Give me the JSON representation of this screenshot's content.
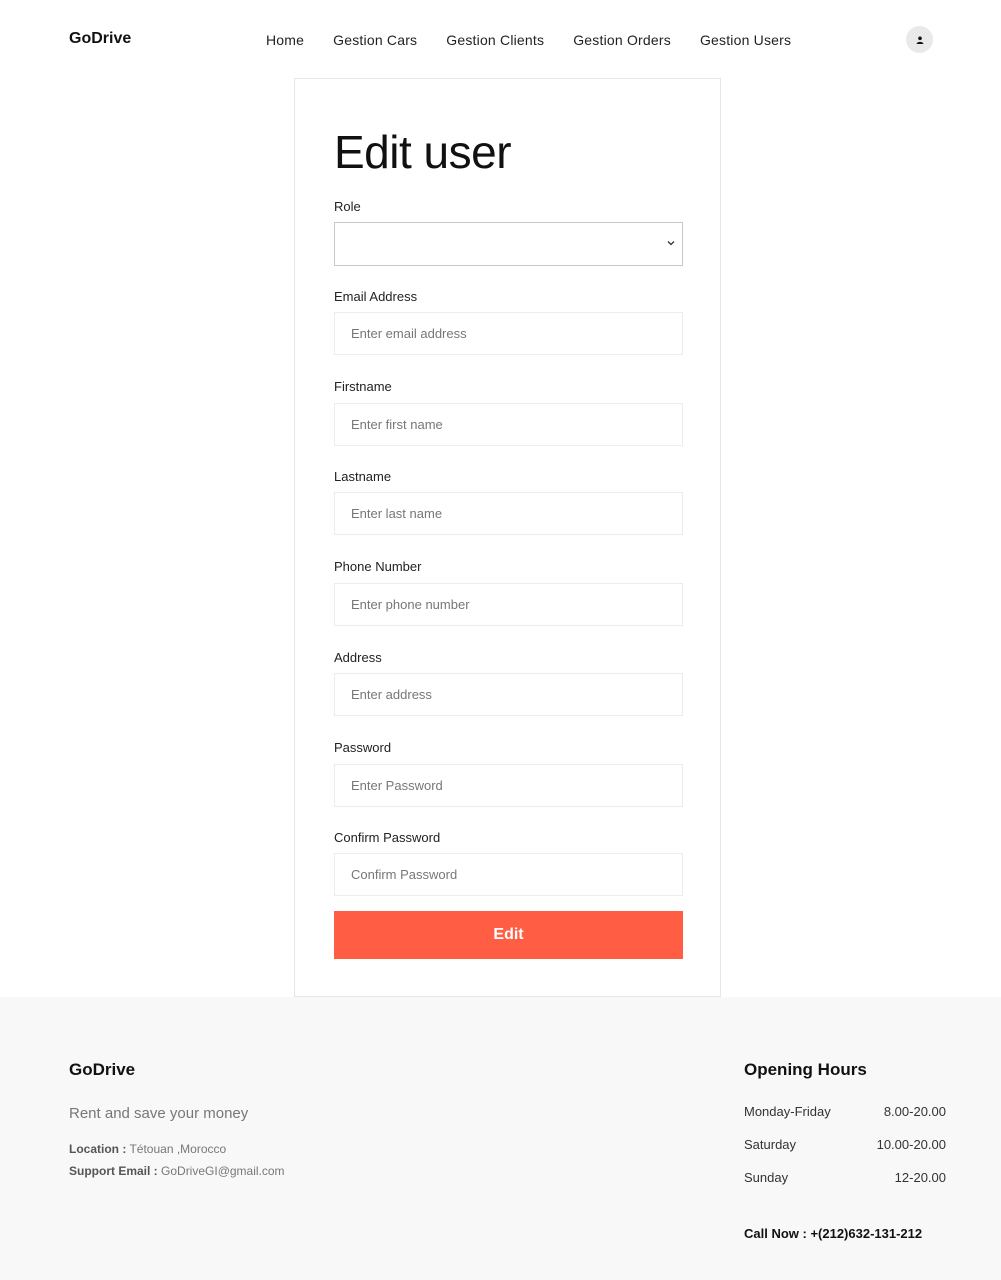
{
  "header": {
    "brand": "GoDrive",
    "nav": [
      {
        "label": "Home"
      },
      {
        "label": "Gestion Cars"
      },
      {
        "label": "Gestion Clients"
      },
      {
        "label": "Gestion Orders"
      },
      {
        "label": "Gestion Users"
      }
    ],
    "avatar_icon": "user-icon"
  },
  "form": {
    "title": "Edit user",
    "role": {
      "label": "Role",
      "value": ""
    },
    "email": {
      "label": "Email Address",
      "placeholder": "Enter email address",
      "value": ""
    },
    "firstname": {
      "label": "Firstname",
      "placeholder": "Enter first name",
      "value": ""
    },
    "lastname": {
      "label": "Lastname",
      "placeholder": "Enter last name",
      "value": ""
    },
    "phone": {
      "label": "Phone Number",
      "placeholder": "Enter phone number",
      "value": ""
    },
    "address": {
      "label": "Address",
      "placeholder": "Enter address",
      "value": ""
    },
    "password": {
      "label": "Password",
      "placeholder": "Enter Password",
      "value": ""
    },
    "confirm_password": {
      "label": "Confirm Password",
      "placeholder": "Confirm Password",
      "value": ""
    },
    "submit_label": "Edit"
  },
  "footer": {
    "brand": "GoDrive",
    "tagline": "Rent and save your money",
    "location_label": "Location :",
    "location_value": "Tétouan ,Morocco",
    "email_label": "Support Email :",
    "email_value": "GoDriveGI@gmail.com",
    "hours_title": "Opening Hours",
    "hours": [
      {
        "day": "Monday-Friday",
        "time": "8.00-20.00"
      },
      {
        "day": "Saturday",
        "time": "10.00-20.00"
      },
      {
        "day": "Sunday",
        "time": "12-20.00"
      }
    ],
    "call_now": "Call Now : +(212)632-131-212"
  },
  "colors": {
    "accent": "#ff5e45",
    "footer_bg": "#f8f8f8"
  }
}
